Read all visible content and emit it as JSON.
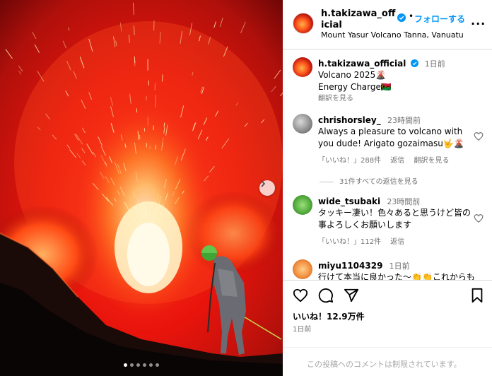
{
  "post": {
    "username": "h.takizawa_official",
    "follow_label": "フォローする",
    "follow_separator": "•",
    "more_label": "...",
    "location": "Mount Yasur Volcano Tanna, Vanuatu"
  },
  "caption": {
    "username": "h.takizawa_official",
    "time": "1日前",
    "line1": "Volcano 2025🌋",
    "line2": "Energy Charge🇻🇺",
    "translate": "翻訳を見る"
  },
  "comments": [
    {
      "username": "chrishorsley_",
      "time": "23時間前",
      "text": "Always a pleasure to volcano with you dude! Arigato gozaimasu🤟🌋",
      "likes": "「いいね！」288件",
      "reply": "返信",
      "translate": "翻訳を見る"
    },
    {
      "username": "wide_tsubaki",
      "time": "23時間前",
      "text": "タッキー凄い！色々あると思うけど皆の事よろしくお願いします",
      "likes": "「いいね！」112件",
      "reply": "返信"
    },
    {
      "username": "miyu1104329",
      "time": "1日前",
      "text": "行けて本当に良かった〜👏👏これからも"
    }
  ],
  "view_replies": "31件すべての返信を見る",
  "likes_total": "いいね！12.9万件",
  "post_date": "1日前",
  "comments_restricted": "この投稿へのコメントは制限されています。",
  "carousel": {
    "count": 6,
    "active": 0
  },
  "colors": {
    "accent": "#0095f6",
    "verified": "#0095f6",
    "muted": "#737373"
  },
  "icons": [
    "chevron-right-icon",
    "verified-badge-icon",
    "heart-icon",
    "comment-icon",
    "share-icon",
    "bookmark-icon"
  ]
}
